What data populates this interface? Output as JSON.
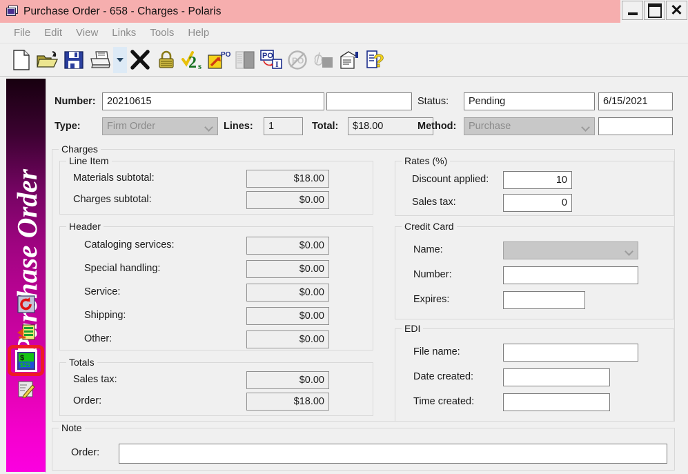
{
  "window": {
    "title": "Purchase Order - 658 - Charges - Polaris",
    "icon": "purchase-order-window-icon",
    "controls": {
      "minimize": "minimize-icon",
      "maximize": "maximize-icon",
      "close": "✕"
    }
  },
  "menu": {
    "items": [
      "File",
      "Edit",
      "View",
      "Links",
      "Tools",
      "Help"
    ]
  },
  "toolbar": {
    "items": [
      {
        "name": "new-icon",
        "tip": "New"
      },
      {
        "name": "open-folder-icon",
        "tip": "Open"
      },
      {
        "name": "save-icon",
        "tip": "Save"
      },
      {
        "name": "print-icon",
        "tip": "Print"
      },
      {
        "name": "print-dropdown-caret-icon",
        "tip": "Print options"
      },
      {
        "name": "delete-x-icon",
        "tip": "Delete"
      },
      {
        "name": "lock-icon",
        "tip": "Lock"
      },
      {
        "name": "check-2s-icon",
        "tip": "Authorize"
      },
      {
        "name": "send-po-icon",
        "tip": "Send purchase order"
      },
      {
        "name": "receive-disabled-icon",
        "tip": "Receive"
      },
      {
        "name": "po-invoice-icon",
        "tip": "Create invoice from PO"
      },
      {
        "name": "cancel-po-disabled-icon",
        "tip": "Cancel purchase order"
      },
      {
        "name": "link-disabled-icon",
        "tip": "Link"
      },
      {
        "name": "properties-icon",
        "tip": "Properties"
      },
      {
        "name": "help-icon",
        "tip": "Help"
      }
    ]
  },
  "sidebar": {
    "title": "Purchase Order",
    "icons": [
      {
        "name": "history-icon",
        "selected": false
      },
      {
        "name": "line-items-icon",
        "selected": false
      },
      {
        "name": "charges-icon",
        "selected": true
      },
      {
        "name": "notes-icon",
        "selected": false
      }
    ]
  },
  "header": {
    "number_label": "Number:",
    "number_value": "20210615",
    "number_secondary_value": "",
    "status_label": "Status:",
    "status_value": "Pending",
    "date_value": "6/15/2021",
    "type_label": "Type:",
    "type_value": "Firm Order",
    "lines_label": "Lines:",
    "lines_value": "1",
    "total_label": "Total:",
    "total_value": "$18.00",
    "method_label": "Method:",
    "method_value": "Purchase",
    "method_secondary_value": ""
  },
  "charges": {
    "group_title": "Charges",
    "line_item": {
      "title": "Line Item",
      "rows": [
        {
          "label": "Materials subtotal:",
          "value": "$18.00"
        },
        {
          "label": "Charges subtotal:",
          "value": "$0.00"
        }
      ]
    },
    "header_section": {
      "title": "Header",
      "rows": [
        {
          "label": "Cataloging services:",
          "value": "$0.00"
        },
        {
          "label": "Special handling:",
          "value": "$0.00"
        },
        {
          "label": "Service:",
          "value": "$0.00"
        },
        {
          "label": "Shipping:",
          "value": "$0.00"
        },
        {
          "label": "Other:",
          "value": "$0.00"
        }
      ]
    },
    "totals": {
      "title": "Totals",
      "rows": [
        {
          "label": "Sales tax:",
          "value": "$0.00"
        },
        {
          "label": "Order:",
          "value": "$18.00"
        }
      ]
    }
  },
  "rates": {
    "title": "Rates (%)",
    "rows": [
      {
        "label": "Discount applied:",
        "value": "10"
      },
      {
        "label": "Sales tax:",
        "value": "0"
      }
    ]
  },
  "credit_card": {
    "title": "Credit Card",
    "name_label": "Name:",
    "name_value": "",
    "number_label": "Number:",
    "number_value": "",
    "expires_label": "Expires:",
    "expires_value": ""
  },
  "edi": {
    "title": "EDI",
    "rows": [
      {
        "label": "File name:",
        "value": ""
      },
      {
        "label": "Date created:",
        "value": ""
      },
      {
        "label": "Time created:",
        "value": ""
      }
    ]
  },
  "note": {
    "title": "Note",
    "order_label": "Order:",
    "order_value": ""
  },
  "colors": {
    "titlebar": "#f6aeae",
    "sidebar_accent": "#e802bb",
    "selection_highlight": "#ed1c24",
    "window_background": "#f0f0f0"
  }
}
